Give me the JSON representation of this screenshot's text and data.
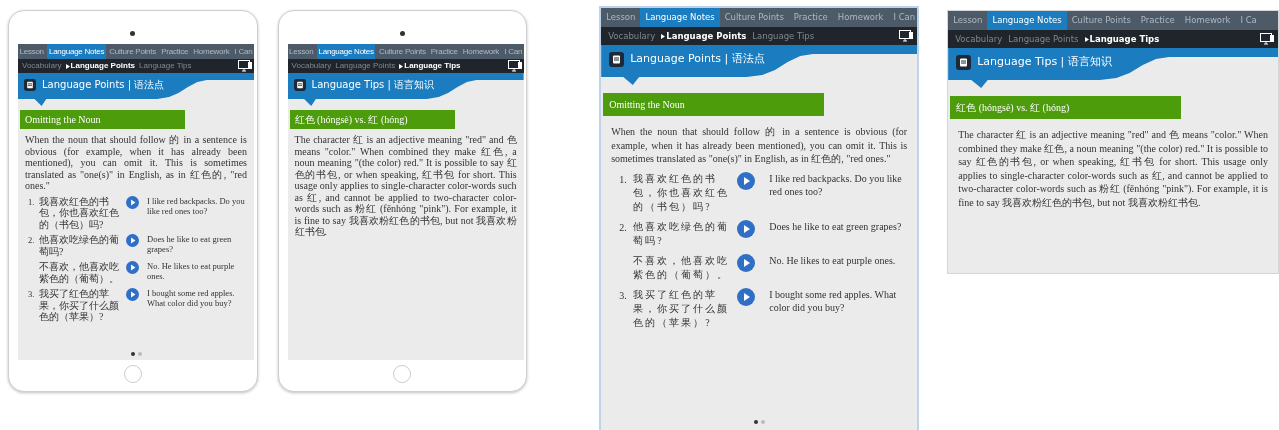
{
  "screens": [
    {
      "kind": "tablet",
      "tabs": [
        {
          "label": "Lesson",
          "selected": false
        },
        {
          "label": "Language Notes",
          "selected": true
        },
        {
          "label": "Culture Points",
          "selected": false
        },
        {
          "label": "Practice",
          "selected": false
        },
        {
          "label": "Homework",
          "selected": false
        },
        {
          "label": "I Can",
          "selected": false
        }
      ],
      "subtabs": [
        {
          "label": "Vocabulary",
          "selected": false
        },
        {
          "label": "Language Points",
          "selected": true
        },
        {
          "label": "Language Tips",
          "selected": false
        }
      ],
      "title": "Language Points | 语法点",
      "heading": "Omitting the Noun",
      "paragraph": "When the noun that should follow 的 in a sentence is obvious (for example, when it has already been mentioned), you can omit it. This is sometimes translated as \"one(s)\" in English, as in 红色的, \"red ones.\"",
      "examples": [
        {
          "number": "1.",
          "chinese": "我喜欢红色的书包，你也喜欢红色的（书包）吗?",
          "english": "I like red backpacks. Do you like red ones too?"
        },
        {
          "number": "2.",
          "chinese": "他喜欢吃绿色的葡萄吗?",
          "english": "Does he like to eat green grapes?"
        },
        {
          "chinese": "不喜欢，他喜欢吃紫色的（葡萄）。",
          "english": "No. He likes to eat purple ones."
        },
        {
          "number": "3.",
          "chinese": "我买了红色的苹果，你买了什么颜色的（苹果）?",
          "english": "I bought some red apples. What color did you buy?"
        }
      ],
      "page_dots": [
        {
          "selected": true
        },
        {
          "selected": false
        }
      ]
    },
    {
      "kind": "tablet",
      "tabs": [
        {
          "label": "Lesson",
          "selected": false
        },
        {
          "label": "Language Notes",
          "selected": true
        },
        {
          "label": "Culture Points",
          "selected": false
        },
        {
          "label": "Practice",
          "selected": false
        },
        {
          "label": "Homework",
          "selected": false
        },
        {
          "label": "I Can",
          "selected": false
        }
      ],
      "subtabs": [
        {
          "label": "Vocabulary",
          "selected": false
        },
        {
          "label": "Language Points",
          "selected": false
        },
        {
          "label": "Language Tips",
          "selected": true
        }
      ],
      "title": "Language Tips | 语言知识",
      "heading": "红色 (hóngsè) vs. 红 (hóng)",
      "paragraph": "The character 红 is an adjective meaning \"red\" and 色 means \"color.\" When combined they make 红色, a noun meaning \"(the color) red.\" It is possible to say 红色的书包, or when speaking, 红书包 for short. This usage only applies to single-character color-words such as 红, and cannot be applied to two-character color-words such as 粉红 (fěnhóng \"pink\"). For example, it is fine to say 我喜欢粉红色的书包, but not 我喜欢粉红书包."
    },
    {
      "kind": "panel",
      "tabs": [
        {
          "label": "Lesson",
          "selected": false
        },
        {
          "label": "Language Notes",
          "selected": true
        },
        {
          "label": "Culture Points",
          "selected": false
        },
        {
          "label": "Practice",
          "selected": false
        },
        {
          "label": "Homework",
          "selected": false
        },
        {
          "label": "I Can",
          "selected": false
        }
      ],
      "subtabs": [
        {
          "label": "Vocabulary",
          "selected": false
        },
        {
          "label": "Language Points",
          "selected": true
        },
        {
          "label": "Language Tips",
          "selected": false
        }
      ],
      "title": "Language Points | 语法点",
      "heading": "Omitting the Noun",
      "paragraph": "When the noun that should follow 的 in a sentence is obvious (for example, when it has already been mentioned), you can omit it. This is sometimes translated as \"one(s)\" in English, as in 红色的, \"red ones.\"",
      "examples": [
        {
          "number": "1.",
          "chinese": "我喜欢红色的书包，你也喜欢红色的（书包）吗?",
          "english": "I like red backpacks. Do you like red ones too?"
        },
        {
          "number": "2.",
          "chinese": "他喜欢吃绿色的葡萄吗?",
          "english": "Does he like to eat green grapes?"
        },
        {
          "chinese": "不喜欢，他喜欢吃紫色的（葡萄）。",
          "english": "No. He likes to eat purple ones."
        },
        {
          "number": "3.",
          "chinese": "我买了红色的苹果，你买了什么颜色的（苹果）?",
          "english": "I bought some red apples. What color did you buy?"
        }
      ],
      "page_dots": [
        {
          "selected": true
        },
        {
          "selected": false
        }
      ]
    },
    {
      "kind": "panel",
      "tabs": [
        {
          "label": "Lesson",
          "selected": false
        },
        {
          "label": "Language Notes",
          "selected": true
        },
        {
          "label": "Culture Points",
          "selected": false
        },
        {
          "label": "Practice",
          "selected": false
        },
        {
          "label": "Homework",
          "selected": false
        },
        {
          "label": "I Ca",
          "selected": false
        }
      ],
      "subtabs": [
        {
          "label": "Vocabulary",
          "selected": false
        },
        {
          "label": "Language Points",
          "selected": false
        },
        {
          "label": "Language Tips",
          "selected": true
        }
      ],
      "title": "Language Tips | 语言知识",
      "heading": "红色 (hóngsè) vs. 红 (hóng)",
      "paragraph": "The character 红 is an adjective meaning \"red\" and 色 means \"color.\" When combined they make 红色, a noun meaning \"(the color) red.\" It is possible to say 红色的书包, or when speaking, 红书包 for short. This usage only applies to single-character color-words such as 红, and cannot be applied to two-character color-words such as 粉红 (fěnhóng \"pink\"). For example, it is fine to say 我喜欢粉红色的书包, but not 我喜欢粉红书包."
    }
  ]
}
